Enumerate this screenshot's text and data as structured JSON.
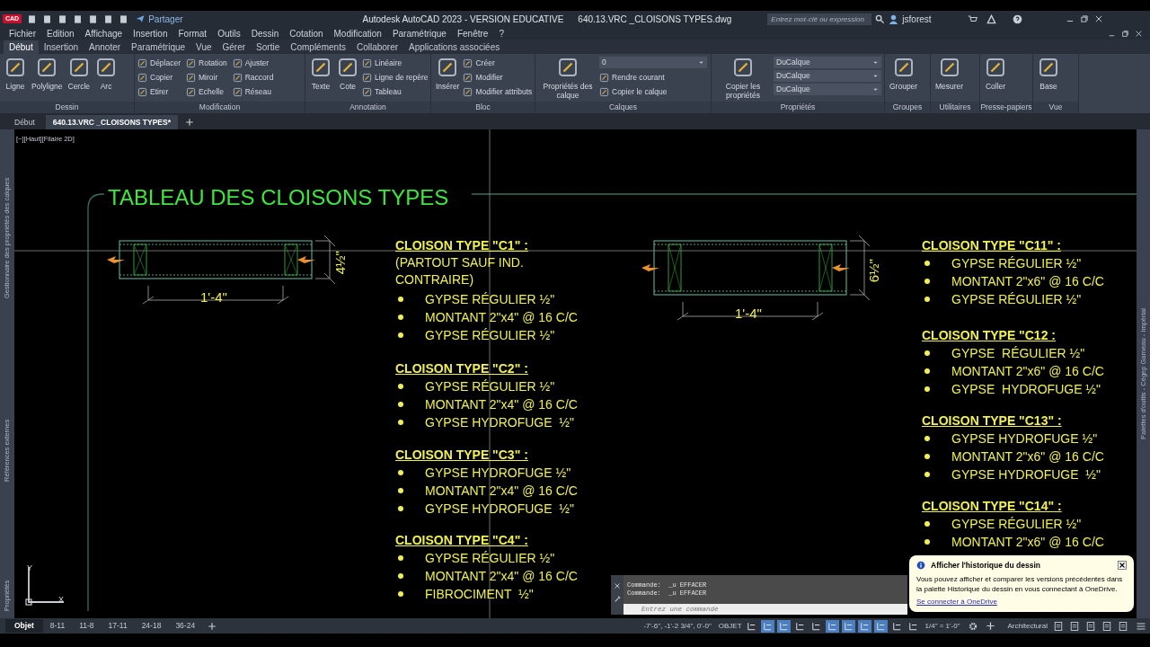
{
  "title_bar": {
    "app_badge": "CAD",
    "share": "Partager",
    "app_title": "Autodesk AutoCAD 2023 - VERSION EDUCATIVE",
    "file_name": "640.13.VRC _CLOISONS TYPES.dwg",
    "search_placeholder": "Entrez mot-clé ou expression",
    "user": "jsforest"
  },
  "menu_bar": [
    "Fichier",
    "Edition",
    "Affichage",
    "Insertion",
    "Format",
    "Outils",
    "Dessin",
    "Cotation",
    "Modification",
    "Paramétrique",
    "Fenêtre",
    "?"
  ],
  "ribbon_tabs": [
    {
      "label": "Début",
      "selected": true
    },
    {
      "label": "Insertion",
      "selected": false
    },
    {
      "label": "Annoter",
      "selected": false
    },
    {
      "label": "Paramétrique",
      "selected": false
    },
    {
      "label": "Vue",
      "selected": false
    },
    {
      "label": "Gérer",
      "selected": false
    },
    {
      "label": "Sortie",
      "selected": false
    },
    {
      "label": "Compléments",
      "selected": false
    },
    {
      "label": "Collaborer",
      "selected": false
    },
    {
      "label": "Applications associées",
      "selected": false
    }
  ],
  "ribbon_panels": [
    {
      "title": "Dessin",
      "tools": [
        {
          "kind": "large",
          "label": "Ligne"
        },
        {
          "kind": "large",
          "label": "Polyligne"
        },
        {
          "kind": "large",
          "label": "Cercle"
        },
        {
          "kind": "large",
          "label": "Arc"
        }
      ]
    },
    {
      "title": "Modification",
      "tools": [
        {
          "kind": "small",
          "label": "Déplacer"
        },
        {
          "kind": "small",
          "label": "Copier"
        },
        {
          "kind": "small",
          "label": "Etirer"
        },
        {
          "kind": "small",
          "label": "Rotation"
        },
        {
          "kind": "small",
          "label": "Miroir"
        },
        {
          "kind": "small",
          "label": "Echelle"
        },
        {
          "kind": "small",
          "label": "Ajuster"
        },
        {
          "kind": "small",
          "label": "Raccord"
        },
        {
          "kind": "small",
          "label": "Réseau"
        }
      ]
    },
    {
      "title": "Annotation",
      "tools": [
        {
          "kind": "large",
          "label": "Texte"
        },
        {
          "kind": "large",
          "label": "Cote"
        },
        {
          "kind": "small",
          "label": "Linéaire"
        },
        {
          "kind": "small",
          "label": "Ligne de repère"
        },
        {
          "kind": "small",
          "label": "Tableau"
        }
      ]
    },
    {
      "title": "Bloc",
      "tools": [
        {
          "kind": "large",
          "label": "Insérer"
        },
        {
          "kind": "small",
          "label": "Créer"
        },
        {
          "kind": "small",
          "label": "Modifier"
        },
        {
          "kind": "small",
          "label": "Modifier attributs"
        }
      ]
    },
    {
      "title": "Calques",
      "tools": [
        {
          "kind": "large",
          "label": "Propriétés des calque"
        },
        {
          "kind": "dropdown",
          "label": "0"
        },
        {
          "kind": "small",
          "label": "Rendre courant"
        },
        {
          "kind": "small",
          "label": "Copier le calque"
        }
      ]
    },
    {
      "title": "Propriétés",
      "tools": [
        {
          "kind": "large",
          "label": "Copier les propriétés"
        },
        {
          "kind": "dropdown",
          "label": "DuCalque"
        },
        {
          "kind": "dropdown",
          "label": "DuCalque"
        },
        {
          "kind": "dropdown",
          "label": "DuCalque"
        }
      ]
    },
    {
      "title": "Groupes",
      "tools": [
        {
          "kind": "large",
          "label": "Grouper"
        }
      ]
    },
    {
      "title": "Utilitaires",
      "tools": [
        {
          "kind": "large",
          "label": "Mesurer"
        }
      ]
    },
    {
      "title": "Presse-papiers",
      "tools": [
        {
          "kind": "large",
          "label": "Coller"
        }
      ]
    },
    {
      "title": "Vue",
      "tools": [
        {
          "kind": "large",
          "label": "Base"
        }
      ]
    }
  ],
  "document_tabs": [
    {
      "label": "Début",
      "selected": false
    },
    {
      "label": "640.13.VRC _CLOISONS TYPES*",
      "selected": true
    }
  ],
  "viewport": {
    "label": "[−][Haut][Filaire 2D]",
    "left_palettes": [
      "Gestionnaire des propriétés des calques",
      "Références externes",
      "Propriétés"
    ],
    "right_palette": "Palettes d'outils - Cégep Garneau - Impérial",
    "ucs_labels": [
      "Y",
      "X"
    ]
  },
  "drawing": {
    "title": "TABLEAU DES CLOISONS TYPES",
    "details": [
      {
        "width_dim": "1'-4\"",
        "thickness_dim": "4½\""
      },
      {
        "width_dim": "1'-4\"",
        "thickness_dim": "6½\""
      }
    ],
    "notes": [
      {
        "heading": "CLOISON TYPE \"C1\" :",
        "subtitle": "(PARTOUT SAUF IND. CONTRAIRE)",
        "items": [
          "GYPSE RÉGULIER ½\"",
          "MONTANT 2\"x4\" @ 16 C/C",
          "GYPSE RÉGULIER ½\""
        ]
      },
      {
        "heading": "CLOISON TYPE \"C2\" :",
        "items": [
          "GYPSE RÉGULIER ½\"",
          "MONTANT 2\"x4\" @ 16 C/C",
          "GYPSE HYDROFUGE  ½\""
        ]
      },
      {
        "heading": "CLOISON TYPE \"C3\" :",
        "items": [
          "GYPSE HYDROFUGE ½\"",
          "MONTANT 2\"x4\" @ 16 C/C",
          "GYPSE HYDROFUGE  ½\""
        ]
      },
      {
        "heading": "CLOISON TYPE \"C4\" :",
        "items": [
          "GYPSE RÉGULIER ½\"",
          "MONTANT 2\"x4\" @ 16 C/C",
          "FIBROCIMENT  ½\""
        ]
      },
      {
        "heading": "CLOISON TYPE \"C11\" :",
        "items": [
          "GYPSE RÉGULIER ½\"",
          "MONTANT 2\"x6\" @ 16 C/C",
          "GYPSE RÉGULIER ½\""
        ]
      },
      {
        "heading": "CLOISON TYPE \"C12 :",
        "items": [
          "GYPSE  RÉGULIER ½\"",
          "MONTANT 2\"x6\" @ 16 C/C",
          "GYPSE  HYDROFUGE ½\""
        ]
      },
      {
        "heading": "CLOISON TYPE \"C13\" :",
        "items": [
          "GYPSE HYDROFUGE ½\"",
          "MONTANT 2\"x6\" @ 16 C/C",
          "GYPSE HYDROFUGE  ½\""
        ]
      },
      {
        "heading": "CLOISON TYPE \"C14\" :",
        "items": [
          "GYPSE RÉGULIER ½\"",
          "MONTANT 2\"x6\" @ 16 C/C"
        ]
      }
    ]
  },
  "command_line": {
    "history": [
      "Commande:  _u EFFACER",
      "Commande:  _u EFFACER"
    ],
    "placeholder": "Entrez une commande"
  },
  "notification": {
    "title": "Afficher l'historique du dessin",
    "body": "Vous pouvez afficher et comparer les versions précédentes dans la palette Historique du dessin en vous connectant à OneDrive.",
    "link": "Se connecter à OneDrive"
  },
  "layout_tabs": [
    {
      "label": "Objet",
      "selected": true
    },
    {
      "label": "8-11",
      "selected": false
    },
    {
      "label": "11-8",
      "selected": false
    },
    {
      "label": "17-11",
      "selected": false
    },
    {
      "label": "24-18",
      "selected": false
    },
    {
      "label": "36-24",
      "selected": false
    }
  ],
  "status_bar": {
    "coordinates": "-7'-6\", -1'-2 3/4\", 0'-0\"",
    "space": "OBJET",
    "toggles": [
      {
        "on": false
      },
      {
        "on": true
      },
      {
        "on": true
      },
      {
        "on": false
      },
      {
        "on": false
      },
      {
        "on": true
      },
      {
        "on": true
      },
      {
        "on": true
      },
      {
        "on": true
      },
      {
        "on": false
      },
      {
        "on": false
      }
    ],
    "scale": "1/4\" = 1'-0\"",
    "units": "Architectural"
  }
}
